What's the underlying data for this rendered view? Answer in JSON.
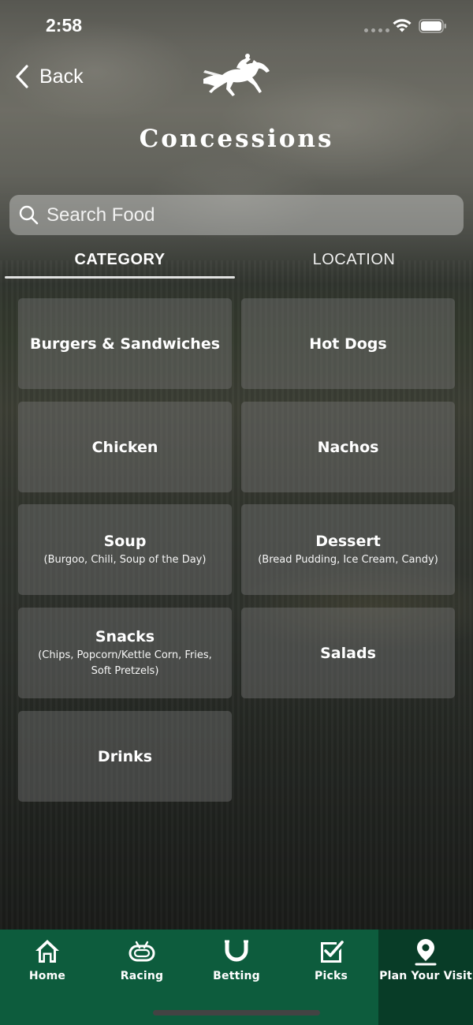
{
  "status_bar": {
    "time": "2:58"
  },
  "header": {
    "back_label": "Back",
    "title": "Concessions"
  },
  "search": {
    "placeholder": "Search Food",
    "value": ""
  },
  "tabs": [
    {
      "label": "CATEGORY",
      "active": true
    },
    {
      "label": "LOCATION",
      "active": false
    }
  ],
  "categories": [
    {
      "title": "Burgers & Sandwiches",
      "subtitle": ""
    },
    {
      "title": "Hot Dogs",
      "subtitle": ""
    },
    {
      "title": "Chicken",
      "subtitle": ""
    },
    {
      "title": "Nachos",
      "subtitle": ""
    },
    {
      "title": "Soup",
      "subtitle": "(Burgoo, Chili, Soup of the Day)"
    },
    {
      "title": "Dessert",
      "subtitle": "(Bread Pudding, Ice Cream, Candy)"
    },
    {
      "title": "Snacks",
      "subtitle": "(Chips, Popcorn/Kettle Corn, Fries, Soft Pretzels)"
    },
    {
      "title": "Salads",
      "subtitle": ""
    },
    {
      "title": "Drinks",
      "subtitle": ""
    }
  ],
  "tabbar": {
    "items": [
      {
        "label": "Home",
        "icon": "home-icon",
        "active": false
      },
      {
        "label": "Racing",
        "icon": "racetrack-icon",
        "active": false
      },
      {
        "label": "Betting",
        "icon": "horseshoe-icon",
        "active": false
      },
      {
        "label": "Picks",
        "icon": "checkbox-icon",
        "active": false
      },
      {
        "label": "Plan Your Visit",
        "icon": "location-pin-icon",
        "active": true
      }
    ]
  },
  "colors": {
    "tabbar_bg": "#0d5c3d",
    "tabbar_active_bg": "#083c27",
    "card_bg": "rgba(120,120,120,0.42)"
  }
}
